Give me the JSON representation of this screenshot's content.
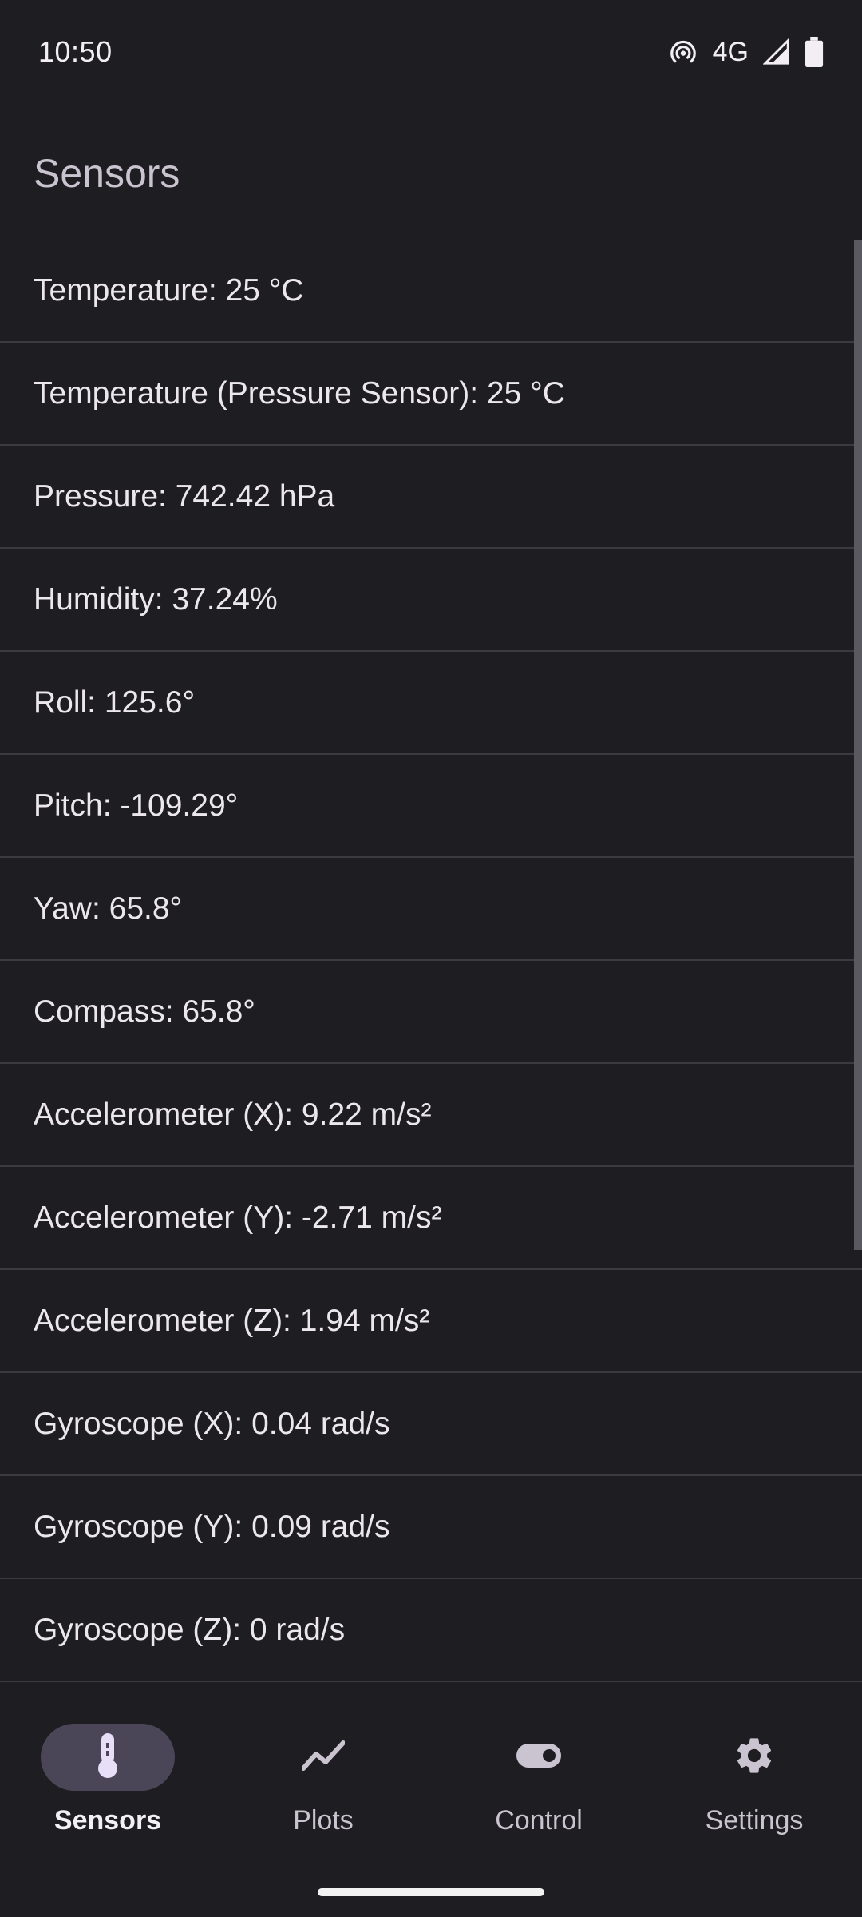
{
  "status_bar": {
    "time": "10:50",
    "network": "4G",
    "icons": [
      "hotspot-icon",
      "signal-icon",
      "battery-icon"
    ]
  },
  "page": {
    "title": "Sensors"
  },
  "sensors": [
    "Temperature: 25 °C",
    "Temperature (Pressure Sensor): 25 °C",
    "Pressure: 742.42 hPa",
    "Humidity: 37.24%",
    "Roll: 125.6°",
    "Pitch: -109.29°",
    "Yaw: 65.8°",
    "Compass: 65.8°",
    "Accelerometer (X): 9.22 m/s²",
    "Accelerometer (Y): -2.71 m/s²",
    "Accelerometer (Z): 1.94 m/s²",
    "Gyroscope (X): 0.04 rad/s",
    "Gyroscope (Y): 0.09 rad/s",
    "Gyroscope (Z): 0 rad/s"
  ],
  "nav": [
    {
      "label": "Sensors",
      "icon": "thermometer-icon",
      "active": true
    },
    {
      "label": "Plots",
      "icon": "trend-line-icon",
      "active": false
    },
    {
      "label": "Control",
      "icon": "toggle-icon",
      "active": false
    },
    {
      "label": "Settings",
      "icon": "gear-icon",
      "active": false
    }
  ],
  "colors": {
    "background": "#1e1d22",
    "divider": "#3b3a41",
    "active_pill": "#4a4658",
    "accent": "#e8def8"
  }
}
